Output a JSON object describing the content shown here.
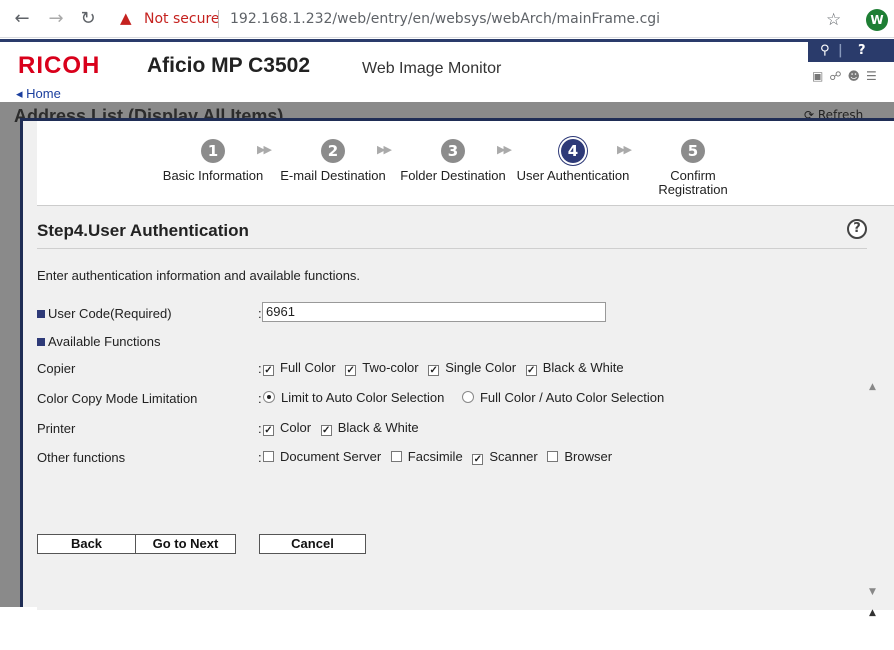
{
  "browser": {
    "not_secure": "Not secure",
    "url": "192.168.1.232/web/entry/en/websys/webArch/mainFrame.cgi",
    "avatar_letter": "W"
  },
  "header": {
    "brand": "RICOH",
    "model": "Aficio MP C3502",
    "app_name": "Web Image Monitor",
    "home_link": "Home"
  },
  "background": {
    "title": "Address List (Display All Items)",
    "refresh": "Refresh"
  },
  "steps": [
    {
      "number": "1",
      "label": "Basic Information",
      "active": false
    },
    {
      "number": "2",
      "label": "E-mail Destination",
      "active": false
    },
    {
      "number": "3",
      "label": "Folder Destination",
      "active": false
    },
    {
      "number": "4",
      "label": "User Authentication",
      "active": true
    },
    {
      "number": "5",
      "label": "Confirm Registration",
      "active": false
    }
  ],
  "page": {
    "heading": "Step4.User Authentication",
    "intro": "Enter authentication information and available functions."
  },
  "form": {
    "user_code_label": "User Code(Required)",
    "user_code_value": "6961",
    "available_functions_label": "Available Functions",
    "copier": {
      "label": "Copier",
      "options": [
        {
          "label": "Full Color",
          "checked": true
        },
        {
          "label": "Two-color",
          "checked": true
        },
        {
          "label": "Single Color",
          "checked": true
        },
        {
          "label": "Black & White",
          "checked": true
        }
      ]
    },
    "color_copy_mode": {
      "label": "Color Copy Mode Limitation",
      "options": [
        {
          "label": "Limit to Auto Color Selection",
          "selected": true
        },
        {
          "label": "Full Color / Auto Color Selection",
          "selected": false
        }
      ]
    },
    "printer": {
      "label": "Printer",
      "options": [
        {
          "label": "Color",
          "checked": true
        },
        {
          "label": "Black & White",
          "checked": true
        }
      ]
    },
    "other_functions": {
      "label": "Other functions",
      "options": [
        {
          "label": "Document Server",
          "checked": false
        },
        {
          "label": "Facsimile",
          "checked": false
        },
        {
          "label": "Scanner",
          "checked": true
        },
        {
          "label": "Browser",
          "checked": false
        }
      ]
    }
  },
  "buttons": {
    "back": "Back",
    "next": "Go to Next",
    "cancel": "Cancel"
  }
}
